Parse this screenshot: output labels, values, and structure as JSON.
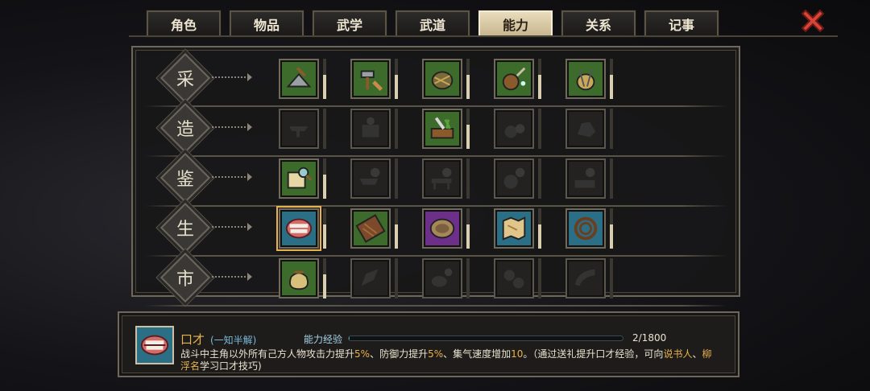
{
  "tabs": [
    {
      "label": "角色",
      "active": false
    },
    {
      "label": "物品",
      "active": false
    },
    {
      "label": "武学",
      "active": false
    },
    {
      "label": "武道",
      "active": false
    },
    {
      "label": "能力",
      "active": true
    },
    {
      "label": "关系",
      "active": false
    },
    {
      "label": "记事",
      "active": false
    }
  ],
  "close_icon": "close-x-icon",
  "rows": [
    {
      "category": "采",
      "skills": [
        {
          "icon": "mining-icon",
          "state": "green",
          "level": 0.6
        },
        {
          "icon": "hammer-axe-icon",
          "state": "green",
          "level": 0.6
        },
        {
          "icon": "basket-icon",
          "state": "green",
          "level": 0.6
        },
        {
          "icon": "gourd-icon",
          "state": "green",
          "level": 0.6
        },
        {
          "icon": "yarn-icon",
          "state": "green",
          "level": 0.6
        }
      ]
    },
    {
      "category": "造",
      "skills": [
        {
          "icon": "anvil-icon",
          "state": "locked",
          "level": 0
        },
        {
          "icon": "stove-icon",
          "state": "locked",
          "level": 0
        },
        {
          "icon": "knife-herb-icon",
          "state": "green",
          "level": 0.6
        },
        {
          "icon": "cauldron-icon",
          "state": "locked",
          "level": 0
        },
        {
          "icon": "ore-icon",
          "state": "locked",
          "level": 0
        }
      ]
    },
    {
      "category": "鉴",
      "skills": [
        {
          "icon": "scroll-magnifier-icon",
          "state": "green",
          "level": 0.6
        },
        {
          "icon": "anvil-magnifier-icon",
          "state": "locked",
          "level": 0
        },
        {
          "icon": "table-magnifier-icon",
          "state": "locked",
          "level": 0
        },
        {
          "icon": "pot-magnifier-icon",
          "state": "locked",
          "level": 0
        },
        {
          "icon": "stone-magnifier-icon",
          "state": "locked",
          "level": 0
        }
      ]
    },
    {
      "category": "生",
      "skills": [
        {
          "icon": "mouth-icon",
          "state": "blue",
          "level": 0.6,
          "selected": true
        },
        {
          "icon": "chocolate-icon",
          "state": "green",
          "level": 0.6
        },
        {
          "icon": "bowl-icon",
          "state": "purple",
          "level": 0.6
        },
        {
          "icon": "map-icon",
          "state": "blue",
          "level": 0.6
        },
        {
          "icon": "whip-icon",
          "state": "blue",
          "level": 0.6
        }
      ]
    },
    {
      "category": "市",
      "skills": [
        {
          "icon": "money-bag-icon",
          "state": "green",
          "level": 0.6
        },
        {
          "icon": "hand-icon",
          "state": "locked",
          "level": 0
        },
        {
          "icon": "spice-bowl-icon",
          "state": "locked",
          "level": 0
        },
        {
          "icon": "gears-icon",
          "state": "locked",
          "level": 0
        },
        {
          "icon": "horn-icon",
          "state": "locked",
          "level": 0
        }
      ]
    }
  ],
  "info": {
    "icon": "mouth-icon",
    "name": "口才",
    "rank": "(一知半解)",
    "exp_label": "能力经验",
    "exp_value": "2/1800",
    "exp_progress": 0.0011,
    "desc": [
      {
        "t": "战斗中主角以外所有己方人物攻击力提升",
        "hl": false
      },
      {
        "t": "5%",
        "hl": true
      },
      {
        "t": "、防御力提升",
        "hl": false
      },
      {
        "t": "5%",
        "hl": true
      },
      {
        "t": "、集气速度增加",
        "hl": false
      },
      {
        "t": "10",
        "hl": true
      },
      {
        "t": "。（通过送礼提升口才经验，可向",
        "hl": false
      },
      {
        "t": "说书人",
        "hl": true
      },
      {
        "t": "、",
        "hl": false
      },
      {
        "t": "柳浮名",
        "hl": true
      },
      {
        "t": "学习口才技巧)",
        "hl": false
      }
    ]
  },
  "colors": {
    "accent": "#e9b24c",
    "green": "#3c6b2c",
    "purple": "#6c2f8a",
    "blue": "#2b6f86"
  }
}
